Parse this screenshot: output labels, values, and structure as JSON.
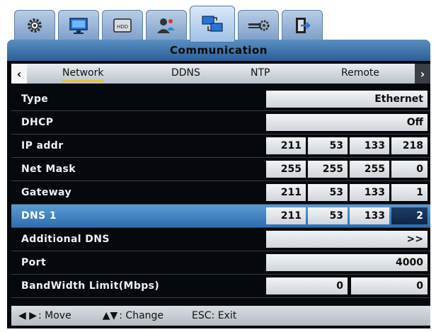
{
  "window": {
    "title": "Communication"
  },
  "menu_tabs": [
    {
      "icon": "gear-icon",
      "active": false
    },
    {
      "icon": "monitor-icon",
      "active": false
    },
    {
      "icon": "hdd-icon",
      "label": "HDD",
      "active": false
    },
    {
      "icon": "user-icon",
      "active": false
    },
    {
      "icon": "network-icon",
      "active": true
    },
    {
      "icon": "settings-slider-icon",
      "active": false
    },
    {
      "icon": "exit-icon",
      "active": false
    }
  ],
  "subtabs": {
    "items": [
      "Network",
      "DDNS",
      "NTP",
      "Remote"
    ],
    "active": "Network"
  },
  "rows": {
    "type": {
      "label": "Type",
      "value": "Ethernet"
    },
    "dhcp": {
      "label": "DHCP",
      "value": "Off"
    },
    "ip": {
      "label": "IP addr",
      "octets": [
        "211",
        "53",
        "133",
        "218"
      ]
    },
    "netmask": {
      "label": "Net Mask",
      "octets": [
        "255",
        "255",
        "255",
        "0"
      ]
    },
    "gateway": {
      "label": "Gateway",
      "octets": [
        "211",
        "53",
        "133",
        "1"
      ]
    },
    "dns1": {
      "label": "DNS 1",
      "octets": [
        "211",
        "53",
        "133",
        "2"
      ]
    },
    "adddns": {
      "label": "Additional DNS",
      "value": ">>"
    },
    "port": {
      "label": "Port",
      "value": "4000"
    },
    "bandwidth": {
      "label": "BandWidth Limit(Mbps)",
      "values": [
        "0",
        "0"
      ]
    }
  },
  "footer": {
    "move": ": Move",
    "change": ": Change",
    "exit": "ESC: Exit"
  }
}
